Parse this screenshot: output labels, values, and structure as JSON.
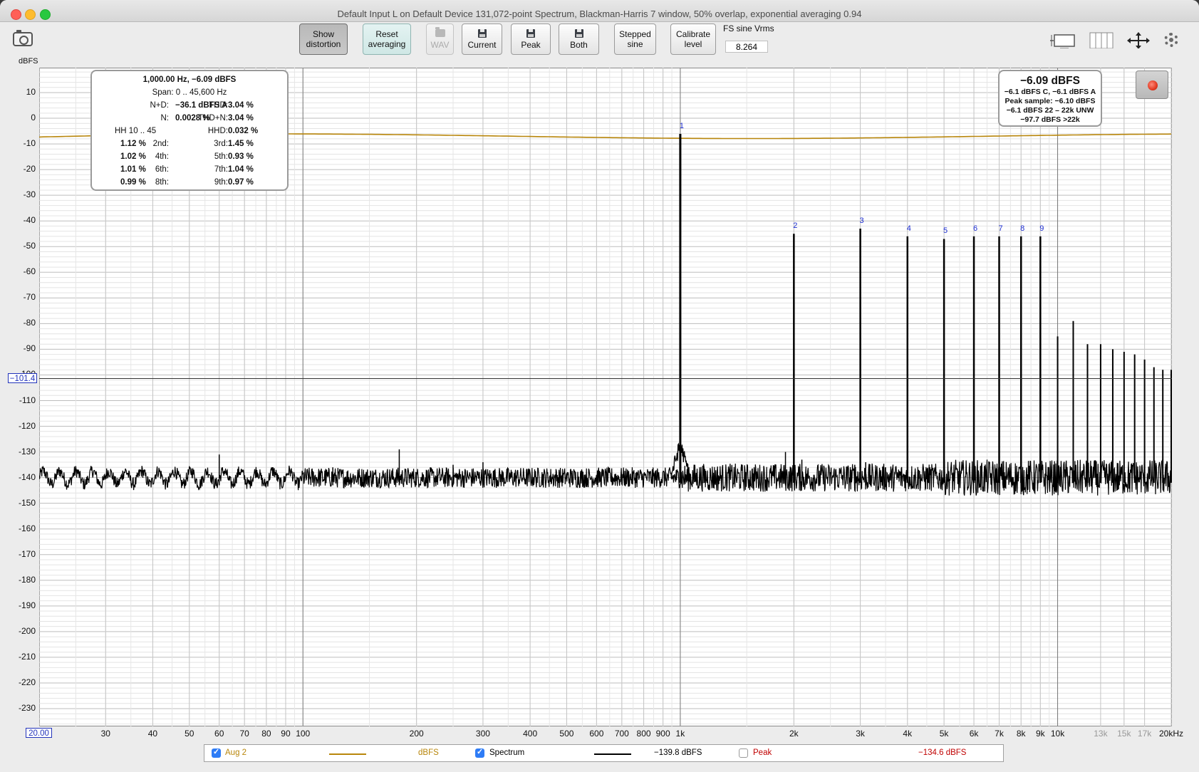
{
  "window": {
    "title": "Default Input L on Default Device 131,072-point Spectrum, Blackman-Harris 7 window, 50% overlap, exponential averaging 0.94"
  },
  "toolbar": {
    "show_distortion": [
      "Show",
      "distortion"
    ],
    "reset_averaging": [
      "Reset",
      "averaging"
    ],
    "wav": "WAV",
    "current": "Current",
    "peak": "Peak",
    "both": "Both",
    "stepped_sine": [
      "Stepped",
      "sine"
    ],
    "calibrate_level": [
      "Calibrate",
      "level"
    ],
    "fs_label": "FS sine Vrms",
    "fs_value": "8.264",
    "accent_pressed": "#bcbcbc",
    "accent_teal": "#d4ecea"
  },
  "icons": {
    "snapshot": "camera-icon",
    "layout1": "single-graph-icon",
    "layout2": "split-graph-icon",
    "axes": "axes-move-icon",
    "settings": "gear-icon",
    "record": "record-icon"
  },
  "y_axis_unit": "dBFS",
  "cursor": {
    "y": "−101.4",
    "x": "20.00"
  },
  "distortion": {
    "title": "1,000.00 Hz, −6.09 dBFS",
    "span": "Span: 0 .. 45,600 Hz",
    "nd_label": "N+D:",
    "nd_value": "−36.1 dBFS A",
    "thd_label": "THD:",
    "thd_value": "3.04 %",
    "n_label": "N:",
    "n_value": "0.0028 %",
    "thdn_label": "THD+N:",
    "thdn_value": "3.04 %",
    "hh": "HH 10 .. 45",
    "hhd_label": "HHD:",
    "hhd_value": "0.032 %",
    "h2_label": "2nd:",
    "h2_value": "1.12 %",
    "h3_label": "3rd:",
    "h3_value": "1.45 %",
    "h4_label": "4th:",
    "h4_value": "1.02 %",
    "h5_label": "5th:",
    "h5_value": "0.93 %",
    "h6_label": "6th:",
    "h6_value": "1.01 %",
    "h7_label": "7th:",
    "h7_value": "1.04 %",
    "h8_label": "8th:",
    "h8_value": "0.99 %",
    "h9_label": "9th:",
    "h9_value": "0.97 %"
  },
  "level_panel": {
    "main": "−6.09 dBFS",
    "line1": "−6.1 dBFS C, −6.1 dBFS A",
    "line2": "Peak sample: −6.10 dBFS",
    "line3": "−6.1 dBFS 22 – 22k UNW",
    "line4": "−97.7 dBFS >22k"
  },
  "legend": {
    "aug_label": "Aug 2",
    "aug_unit": "dBFS",
    "aug_color": "#b8860b",
    "spectrum_label": "Spectrum",
    "spectrum_value": "−139.8 dBFS",
    "spectrum_color": "#000000",
    "peak_label": "Peak",
    "peak_value": "−134.6 dBFS",
    "peak_color": "#c00000"
  },
  "chart_data": {
    "type": "line",
    "x_scale": "log",
    "xlim": [
      20,
      20000
    ],
    "ylim": [
      -240,
      20
    ],
    "ylabel": "dBFS",
    "grid": true,
    "y_ticks": [
      "10",
      "0",
      "-10",
      "-20",
      "-30",
      "-40",
      "-50",
      "-60",
      "-70",
      "-80",
      "-90",
      "-100",
      "-110",
      "-120",
      "-130",
      "-140",
      "-150",
      "-160",
      "-170",
      "-180",
      "-190",
      "-200",
      "-210",
      "-220",
      "-230"
    ],
    "x_ticks": [
      {
        "v": 20,
        "t": ""
      },
      {
        "v": 30,
        "t": "30"
      },
      {
        "v": 40,
        "t": "40"
      },
      {
        "v": 50,
        "t": "50"
      },
      {
        "v": 60,
        "t": "60"
      },
      {
        "v": 70,
        "t": "70"
      },
      {
        "v": 80,
        "t": "80"
      },
      {
        "v": 90,
        "t": "90"
      },
      {
        "v": 100,
        "t": "100"
      },
      {
        "v": 200,
        "t": "200"
      },
      {
        "v": 300,
        "t": "300"
      },
      {
        "v": 400,
        "t": "400"
      },
      {
        "v": 500,
        "t": "500"
      },
      {
        "v": 600,
        "t": "600"
      },
      {
        "v": 700,
        "t": "700"
      },
      {
        "v": 800,
        "t": "800"
      },
      {
        "v": 900,
        "t": "900"
      },
      {
        "v": 1000,
        "t": "1k"
      },
      {
        "v": 2000,
        "t": "2k"
      },
      {
        "v": 3000,
        "t": "3k"
      },
      {
        "v": 4000,
        "t": "4k"
      },
      {
        "v": 5000,
        "t": "5k"
      },
      {
        "v": 6000,
        "t": "6k"
      },
      {
        "v": 7000,
        "t": "7k"
      },
      {
        "v": 8000,
        "t": "8k"
      },
      {
        "v": 9000,
        "t": "9k"
      },
      {
        "v": 10000,
        "t": "10k"
      },
      {
        "v": 13000,
        "t": "13k"
      },
      {
        "v": 15000,
        "t": "15k"
      },
      {
        "v": 17000,
        "t": "17k"
      },
      {
        "v": 20000,
        "t": "20kHz"
      }
    ],
    "grey_ticks": [
      "13k",
      "15k",
      "17k"
    ],
    "cursor_level": -101.4,
    "fundamental": {
      "f": 1000,
      "db": -6.1
    },
    "harmonics": [
      {
        "n": "1",
        "f": 1000,
        "db": -6.1
      },
      {
        "n": "2",
        "f": 2000,
        "db": -45
      },
      {
        "n": "3",
        "f": 3000,
        "db": -43
      },
      {
        "n": "4",
        "f": 4000,
        "db": -46
      },
      {
        "n": "5",
        "f": 5000,
        "db": -47
      },
      {
        "n": "6",
        "f": 6000,
        "db": -46
      },
      {
        "n": "7",
        "f": 7000,
        "db": -46
      },
      {
        "n": "8",
        "f": 8000,
        "db": -46
      },
      {
        "n": "9",
        "f": 9000,
        "db": -46
      }
    ],
    "upper_harmonics": [
      {
        "f": 10000,
        "db": -85
      },
      {
        "f": 11000,
        "db": -79
      },
      {
        "f": 12000,
        "db": -88
      },
      {
        "f": 13000,
        "db": -88
      },
      {
        "f": 14000,
        "db": -90
      },
      {
        "f": 15000,
        "db": -91
      },
      {
        "f": 16000,
        "db": -92
      },
      {
        "f": 17000,
        "db": -94
      },
      {
        "f": 18000,
        "db": -97
      },
      {
        "f": 19000,
        "db": -98
      },
      {
        "f": 20000,
        "db": -98
      }
    ],
    "small_spurs": [
      {
        "f": 60,
        "db": -131
      },
      {
        "f": 180,
        "db": -129
      },
      {
        "f": 120,
        "db": -136
      },
      {
        "f": 250,
        "db": -135
      },
      {
        "f": 300,
        "db": -134
      },
      {
        "f": 1900,
        "db": -130
      },
      {
        "f": 2100,
        "db": -133
      },
      {
        "f": 2900,
        "db": -135
      },
      {
        "f": 3100,
        "db": -134
      },
      {
        "f": 3500,
        "db": -136
      }
    ],
    "aug_level_db": -7,
    "noise_floor_db": -140,
    "series": [
      {
        "name": "Aug 2",
        "color": "#b8860b"
      },
      {
        "name": "Spectrum",
        "color": "#000000"
      },
      {
        "name": "Peak",
        "color": "#c00000"
      }
    ]
  }
}
